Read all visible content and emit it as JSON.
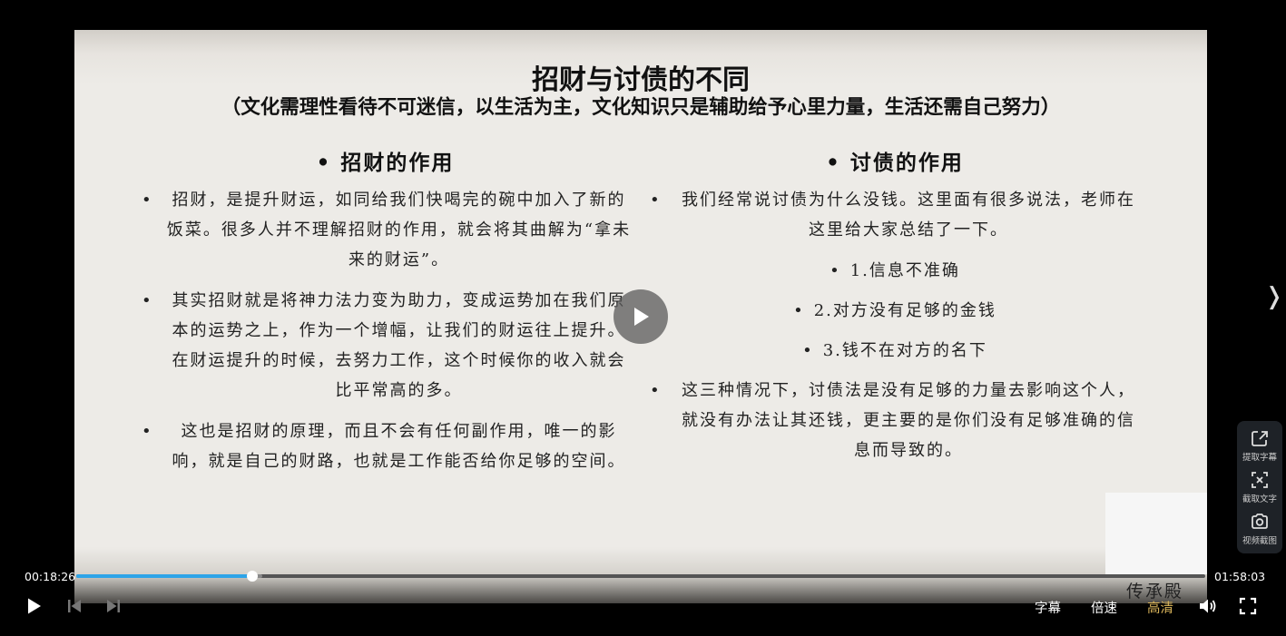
{
  "slide": {
    "title": "招财与讨债的不同",
    "subtitle": "（文化需理性看待不可迷信，以生活为主，文化知识只是辅助给予心里力量，生活还需自己努力）",
    "bullet_glyph": "•",
    "left_heading": "招财的作用",
    "left_bullets": [
      "招财，是提升财运，如同给我们快喝完的碗中加入了新的饭菜。很多人并不理解招财的作用，就会将其曲解为“拿未来的财运”。",
      "其实招财就是将神力法力变为助力，变成运势加在我们原本的运势之上，作为一个增幅，让我们的财运往上提升。在财运提升的时候，去努力工作，这个时候你的收入就会比平常高的多。",
      "这也是招财的原理，而且不会有任何副作用，唯一的影响，就是自己的财路，也就是工作能否给你足够的空间。"
    ],
    "right_heading": "讨债的作用",
    "right_intro": "我们经常说讨债为什么没钱。这里面有很多说法，老师在这里给大家总结了一下。",
    "right_points": [
      "1.信息不准确",
      "2.对方没有足够的金钱",
      "3.钱不在对方的名下"
    ],
    "right_conclusion": "这三种情况下，讨债法是没有足够的力量去影响这个人，就没有办法让其还钱，更主要的是你们没有足够准确的信息而导致的。",
    "watermark": "传承殿"
  },
  "player": {
    "current_time": "00:18:26",
    "total_time": "01:58:03",
    "progress_fraction": 0.156,
    "buffered_fraction": 0.165,
    "subtitles_label": "字幕",
    "speed_label": "倍速",
    "quality_label": "高清",
    "next_glyph": "❭",
    "accent_color": "#2ea4e8",
    "active_color": "#d9b45a"
  },
  "side_tools": [
    {
      "label": "提取字幕",
      "icon": "share-export-icon"
    },
    {
      "label": "截取文字",
      "icon": "text-scan-icon"
    },
    {
      "label": "视频截图",
      "icon": "camera-icon"
    }
  ]
}
